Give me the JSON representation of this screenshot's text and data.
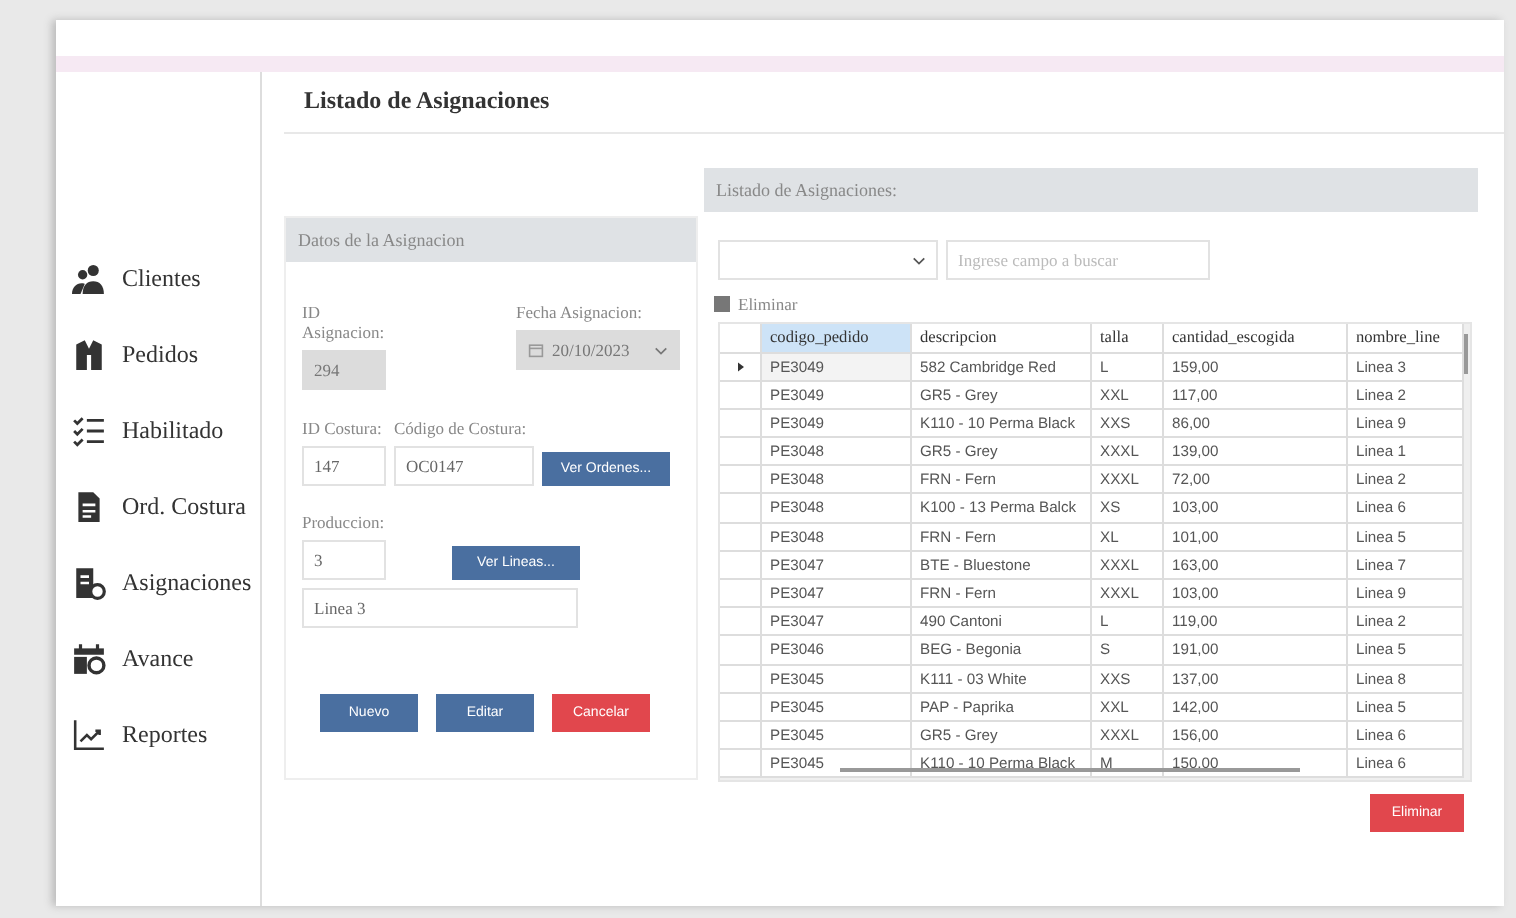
{
  "page_title": "Listado de Asignaciones",
  "sidebar": {
    "items": [
      {
        "label": "Clientes"
      },
      {
        "label": "Pedidos"
      },
      {
        "label": "Habilitado"
      },
      {
        "label": "Ord. Costura"
      },
      {
        "label": "Asignaciones"
      },
      {
        "label": "Avance"
      },
      {
        "label": "Reportes"
      }
    ]
  },
  "form": {
    "title": "Datos de la Asignacion",
    "id_asignacion": {
      "label": "ID Asignacion:",
      "value": "294",
      "disabled": true
    },
    "fecha": {
      "label": "Fecha Asignacion:",
      "value": "20/10/2023",
      "disabled": true
    },
    "id_costura": {
      "label": "ID Costura:",
      "value": "147",
      "disabled": false
    },
    "codigo_costura": {
      "label": "Código de Costura:",
      "value": "OC0147",
      "disabled": false
    },
    "ver_ordenes": "Ver Ordenes...",
    "produccion": {
      "label": "Produccion:",
      "value": "3",
      "disabled": false
    },
    "ver_lineas": "Ver Lineas...",
    "linea": {
      "value": "Linea 3",
      "disabled": false
    },
    "buttons": [
      {
        "label": "Nuevo",
        "kind": "primary"
      },
      {
        "label": "Editar",
        "kind": "primary"
      },
      {
        "label": "Cancelar",
        "kind": "danger"
      }
    ]
  },
  "list": {
    "title": "Listado de Asignaciones:",
    "search": {
      "placeholder": "Ingrese campo a buscar"
    },
    "toolbar_button": "Eliminar",
    "columns": [
      {
        "label": "codigo_pedido",
        "selected": true
      },
      {
        "label": "descripcion",
        "selected": false
      },
      {
        "label": "talla",
        "selected": false
      },
      {
        "label": "cantidad_escogida",
        "selected": false
      },
      {
        "label": "nombre_line",
        "selected": false
      }
    ],
    "rows": [
      {
        "cells": [
          "PE3049",
          "582 Cambridge Red",
          "L",
          "159,00",
          "Linea 3"
        ],
        "selected": true
      },
      {
        "cells": [
          "PE3049",
          "GR5 - Grey",
          "XXL",
          "117,00",
          "Linea 2"
        ],
        "selected": false
      },
      {
        "cells": [
          "PE3049",
          "K110 - 10 Perma Black",
          "XXS",
          "86,00",
          "Linea 9"
        ],
        "selected": false
      },
      {
        "cells": [
          "PE3048",
          "GR5 - Grey",
          "XXXL",
          "139,00",
          "Linea 1"
        ],
        "selected": false
      },
      {
        "cells": [
          "PE3048",
          "FRN - Fern",
          "XXXL",
          "72,00",
          "Linea 2"
        ],
        "selected": false
      },
      {
        "cells": [
          "PE3048",
          "K100 - 13 Perma Balck",
          "XS",
          "103,00",
          "Linea 6"
        ],
        "selected": false
      },
      {
        "cells": [
          "PE3048",
          "FRN - Fern",
          "XL",
          "101,00",
          "Linea 5"
        ],
        "selected": false
      },
      {
        "cells": [
          "PE3047",
          "BTE - Bluestone",
          "XXXL",
          "163,00",
          "Linea 7"
        ],
        "selected": false
      },
      {
        "cells": [
          "PE3047",
          "FRN - Fern",
          "XXXL",
          "103,00",
          "Linea 9"
        ],
        "selected": false
      },
      {
        "cells": [
          "PE3047",
          "490 Cantoni",
          "L",
          "119,00",
          "Linea 2"
        ],
        "selected": false
      },
      {
        "cells": [
          "PE3046",
          "BEG - Begonia",
          "S",
          "191,00",
          "Linea 5"
        ],
        "selected": false
      },
      {
        "cells": [
          "PE3045",
          "K111 - 03 White",
          "XXS",
          "137,00",
          "Linea 8"
        ],
        "selected": false
      },
      {
        "cells": [
          "PE3045",
          "PAP - Paprika",
          "XXL",
          "142,00",
          "Linea 5"
        ],
        "selected": false
      },
      {
        "cells": [
          "PE3045",
          "GR5 - Grey",
          "XXXL",
          "156,00",
          "Linea 6"
        ],
        "selected": false
      },
      {
        "cells": [
          "PE3045",
          "K110 - 10 Perma Black",
          "M",
          "150,00",
          "Linea 6"
        ],
        "selected": false
      }
    ],
    "delete_button": "Eliminar"
  }
}
